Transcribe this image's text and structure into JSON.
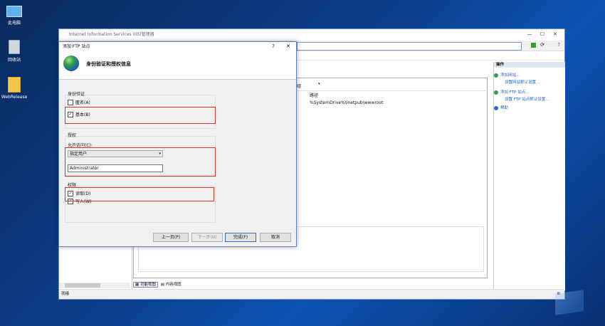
{
  "desktop": {
    "icons": [
      {
        "label": "此电脑",
        "icon": "computer-icon"
      },
      {
        "label": "回收站",
        "icon": "recycle-bin-icon"
      },
      {
        "label": "WebRelease",
        "icon": "folder-icon"
      }
    ]
  },
  "iis_window": {
    "title": "Internet Information Services (IIS)管理器",
    "columns": {
      "col1": "组",
      "col2": "路径"
    },
    "row": {
      "path": "%SystemDrive%\\inetpub\\wwwroot"
    },
    "actions": {
      "header": "操作",
      "items": [
        "添加网站...",
        "设置网站默认设置...",
        "添加 FTP 站点...",
        "设置 FTP 站点默认设置...",
        "帮助"
      ]
    },
    "view_tabs": [
      "功能视图",
      "内容视图"
    ],
    "status": "就绪"
  },
  "dialog": {
    "title": "添加 FTP 站点",
    "help": "?",
    "close": "✕",
    "heading": "身份验证和授权信息",
    "auth_section": {
      "label": "身份验证",
      "anonymous": {
        "label": "匿名(A)",
        "checked": false
      },
      "basic": {
        "label": "基本(B)",
        "checked": true
      }
    },
    "authz_section": {
      "label": "授权",
      "allow_access_label": "允许访问(C):",
      "allow_access_value": "指定用户",
      "user_value": "Administrator"
    },
    "perm_section": {
      "label": "权限",
      "read": {
        "label": "读取(D)",
        "checked": true
      },
      "write": {
        "label": "写入(W)",
        "checked": true
      }
    },
    "buttons": {
      "prev": "上一页(P)",
      "next": "下一步(N)",
      "finish": "完成(F)",
      "cancel": "取消"
    }
  },
  "colors": {
    "highlight": "#d93030",
    "link": "#1a62c4"
  }
}
